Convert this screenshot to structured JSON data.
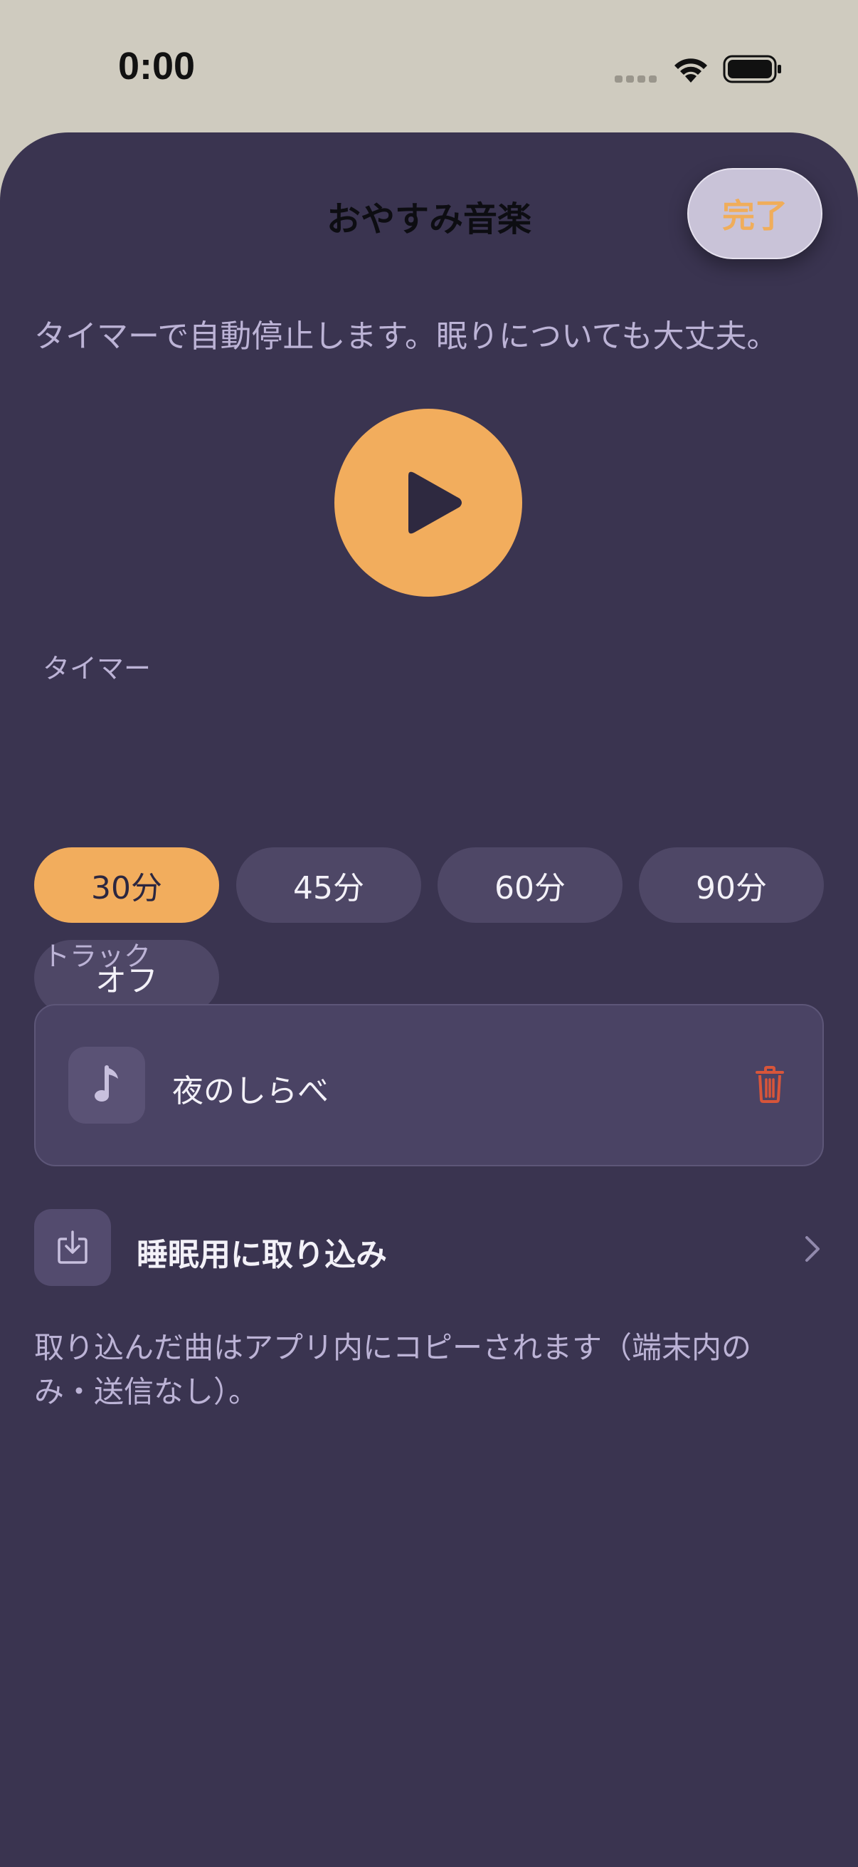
{
  "status_bar": {
    "time": "0:00"
  },
  "sheet": {
    "title": "おやすみ音楽",
    "done_label": "完了",
    "description": "タイマーで自動停止します。眠りについても大丈夫。"
  },
  "player": {
    "play_icon": "play-icon",
    "accent_color": "#f2ad5d"
  },
  "timer": {
    "label": "タイマー",
    "options": [
      "30分",
      "45分",
      "60分",
      "90分",
      "オフ"
    ],
    "selected": "30分"
  },
  "tracks": {
    "label": "トラック",
    "items": [
      {
        "name": "夜のしらべ",
        "icon": "music-note-icon",
        "delete_icon": "trash-icon"
      }
    ]
  },
  "import": {
    "label": "睡眠用に取り込み",
    "icon": "download-icon",
    "chevron": "chevron-right-icon"
  },
  "footnote": "取り込んだ曲はアプリ内にコピーされます（端末内のみ・送信なし）。",
  "colors": {
    "background": "#3a3450",
    "accent": "#f2ad5d",
    "destructive": "#d7553a",
    "secondary_text": "#bcb3d6"
  }
}
